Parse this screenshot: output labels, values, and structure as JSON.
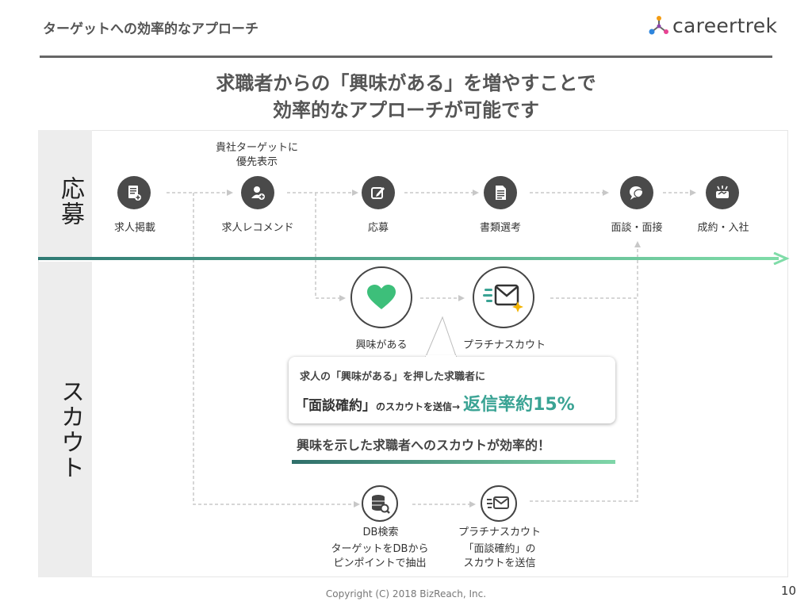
{
  "header": {
    "title": "ターゲットへの効率的なアプローチ",
    "logo_text": "careertrek"
  },
  "headline": {
    "line1": "求職者からの「興味がある」を増やすことで",
    "line2": "効率的なアプローチが可能です"
  },
  "sections": {
    "apply_label": "応募",
    "scout_label": "スカウト"
  },
  "apply_flow": {
    "steps": [
      {
        "label": "求人掲載",
        "icon": "document-plus-icon"
      },
      {
        "label": "求人レコメンド",
        "icon": "user-plus-icon"
      },
      {
        "label": "応募",
        "icon": "edit-icon"
      },
      {
        "label": "書類選考",
        "icon": "document-list-icon"
      },
      {
        "label": "面談・面接",
        "icon": "chat-bubbles-icon"
      },
      {
        "label": "成約・入社",
        "icon": "handshake-icon"
      }
    ],
    "recommend_note_line1": "貴社ターゲットに",
    "recommend_note_line2": "優先表示"
  },
  "scout_flow": {
    "interest_label": "興味がある",
    "platinum_label": "プラチナスカウト",
    "callout_line1": "求人の「興味がある」を押した求職者に",
    "callout_part_a": "「面談確約」",
    "callout_part_b": "のスカウトを送信→",
    "callout_rate": "返信率約15%",
    "tagline": "興味を示した求職者へのスカウトが効率的！",
    "db_label": "DB検索",
    "db_note_line1": "ターゲットをDBから",
    "db_note_line2": "ピンポイントで抽出",
    "platinum2_label": "プラチナスカウト",
    "platinum2_note_line1": "「面談確約」の",
    "platinum2_note_line2": "スカウトを送信"
  },
  "footer": {
    "copyright": "Copyright (C) 2018 BizReach, Inc.",
    "page_number": "10"
  },
  "colors": {
    "accent_teal": "#3aa394",
    "heart_green": "#3dbf7a",
    "icon_dark": "#4a4a4a",
    "dashed_line": "#c8c8c8"
  }
}
